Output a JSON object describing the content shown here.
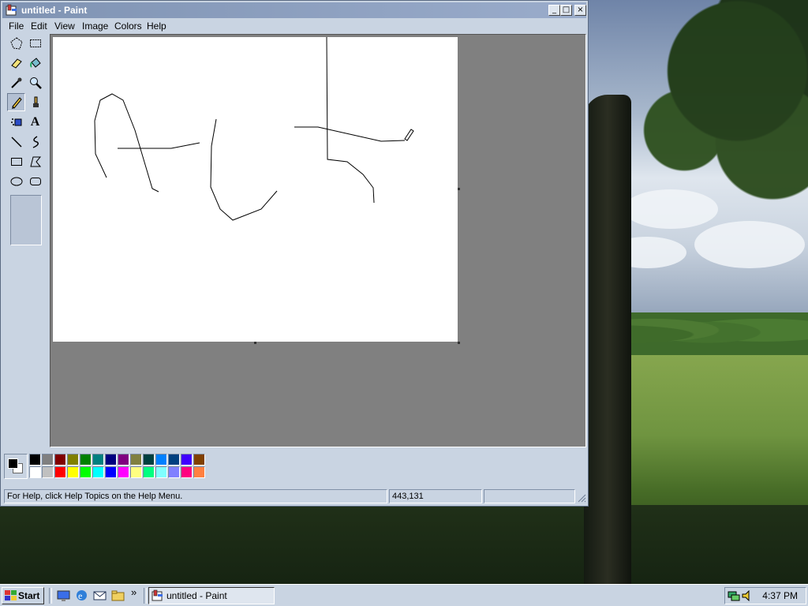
{
  "window": {
    "title": "untitled - Paint",
    "controls": {
      "minimize": "_",
      "maximize": "□",
      "close": "×"
    }
  },
  "menu": {
    "items": [
      "File",
      "Edit",
      "View",
      "Image",
      "Colors",
      "Help"
    ]
  },
  "toolbox": {
    "tools": [
      {
        "name": "free-form-select",
        "icon": "free-select-icon"
      },
      {
        "name": "select",
        "icon": "rect-select-icon"
      },
      {
        "name": "eraser",
        "icon": "eraser-icon"
      },
      {
        "name": "fill-with-color",
        "icon": "bucket-icon"
      },
      {
        "name": "pick-color",
        "icon": "eyedropper-icon"
      },
      {
        "name": "magnifier",
        "icon": "magnifier-icon"
      },
      {
        "name": "pencil",
        "icon": "pencil-icon",
        "active": true
      },
      {
        "name": "brush",
        "icon": "brush-icon"
      },
      {
        "name": "airbrush",
        "icon": "airbrush-icon"
      },
      {
        "name": "text",
        "icon": "text-icon",
        "glyph": "A"
      },
      {
        "name": "line",
        "icon": "line-icon"
      },
      {
        "name": "curve",
        "icon": "curve-icon"
      },
      {
        "name": "rectangle",
        "icon": "rectangle-icon"
      },
      {
        "name": "polygon",
        "icon": "polygon-icon"
      },
      {
        "name": "ellipse",
        "icon": "ellipse-icon"
      },
      {
        "name": "rounded-rectangle",
        "icon": "rounded-rect-icon"
      }
    ]
  },
  "palette": {
    "foreground": "#000000",
    "background": "#ffffff",
    "row1": [
      "#000000",
      "#808080",
      "#800000",
      "#808000",
      "#008000",
      "#008080",
      "#000080",
      "#800080",
      "#808040",
      "#004040",
      "#0080ff",
      "#004080",
      "#4000ff",
      "#804000"
    ],
    "row2": [
      "#ffffff",
      "#c0c0c0",
      "#ff0000",
      "#ffff00",
      "#00ff00",
      "#00ffff",
      "#0000ff",
      "#ff00ff",
      "#ffff80",
      "#00ff80",
      "#80ffff",
      "#8080ff",
      "#ff0080",
      "#ff8040"
    ]
  },
  "status": {
    "help_text": "For Help, click Help Topics on the Help Menu.",
    "coordinates": "443,131",
    "size": ""
  },
  "taskbar": {
    "start_label": "Start",
    "quick_launch": [
      "desktop-icon",
      "internet-explorer-icon",
      "outlook-icon",
      "folder-icon"
    ],
    "overflow": "»",
    "task_button_label": "untitled - Paint",
    "clock": "4:37 PM",
    "tray_icons": [
      "network-icon",
      "volume-icon"
    ]
  }
}
